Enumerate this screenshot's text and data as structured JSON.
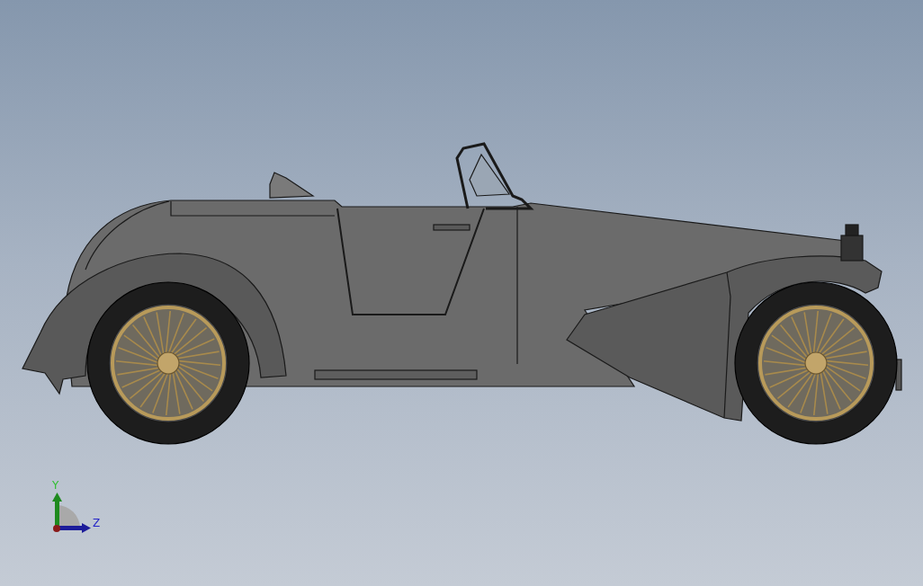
{
  "viewport": {
    "model": {
      "kind": "car"
    },
    "triad": {
      "axes": [
        {
          "kind": "vertical",
          "label": "Y",
          "color": "#1e8a1e"
        },
        {
          "kind": "horizontal",
          "label": "Z",
          "color": "#1c1c9a"
        }
      ]
    }
  }
}
